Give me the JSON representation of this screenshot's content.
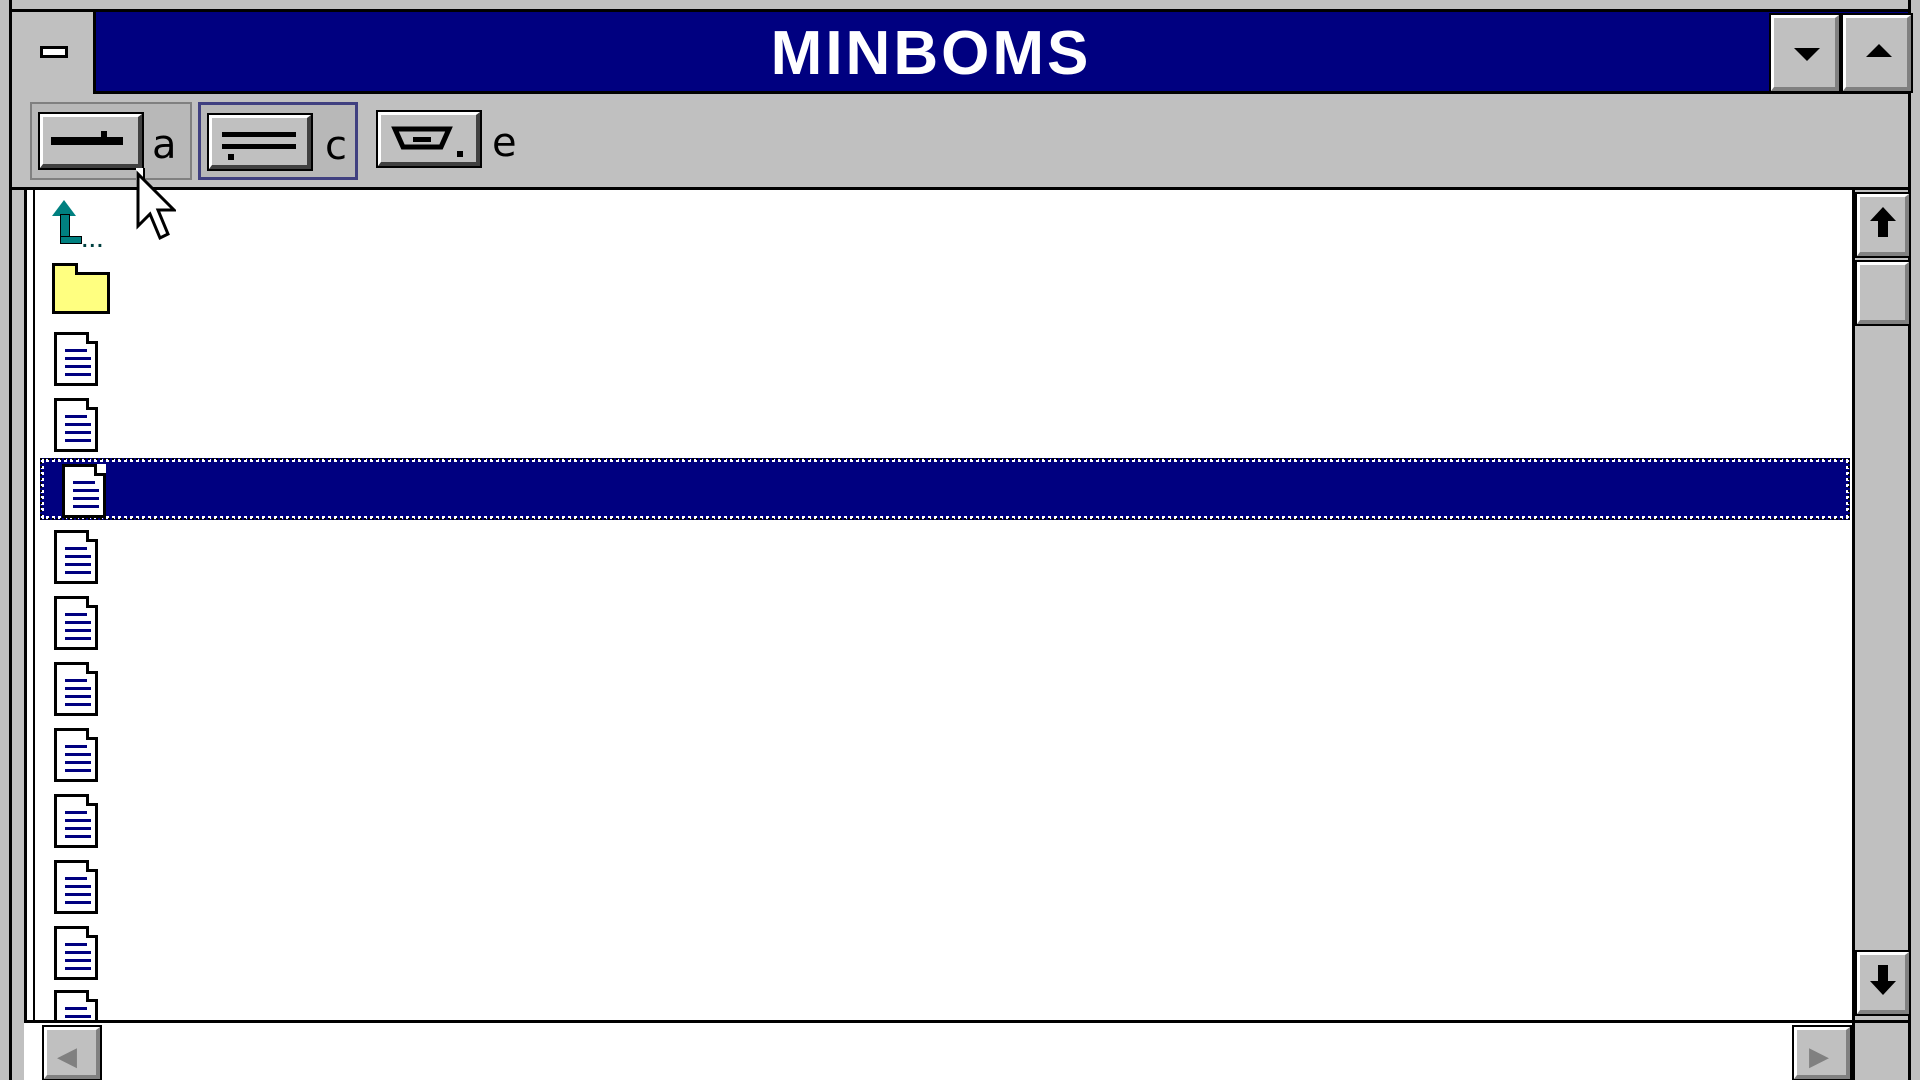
{
  "window": {
    "title": "MINBOMS",
    "title_color": "#ffffff",
    "titlebar_color": "#000080"
  },
  "toolbar": {
    "tools": [
      {
        "icon": "tree-view-icon",
        "letter": "a"
      },
      {
        "icon": "list-view-icon",
        "letter": "c"
      },
      {
        "icon": "drive-icon",
        "letter": "e"
      }
    ]
  },
  "file_list": {
    "rows": [
      {
        "type": "parent-dir",
        "icon": "up-arrow-icon",
        "label": "..."
      },
      {
        "type": "folder",
        "icon": "folder-icon"
      },
      {
        "type": "file",
        "icon": "document-icon"
      },
      {
        "type": "file",
        "icon": "document-icon"
      },
      {
        "type": "file",
        "icon": "document-icon",
        "selected": true
      },
      {
        "type": "file",
        "icon": "document-icon"
      },
      {
        "type": "file",
        "icon": "document-icon"
      },
      {
        "type": "file",
        "icon": "document-icon"
      },
      {
        "type": "file",
        "icon": "document-icon"
      },
      {
        "type": "file",
        "icon": "document-icon"
      },
      {
        "type": "file",
        "icon": "document-icon"
      },
      {
        "type": "file",
        "icon": "document-icon"
      },
      {
        "type": "file",
        "icon": "document-icon"
      }
    ],
    "selection_color": "#000080"
  },
  "scrollbars": {
    "vertical_position": 0.0,
    "horizontal_position": 0.0
  }
}
